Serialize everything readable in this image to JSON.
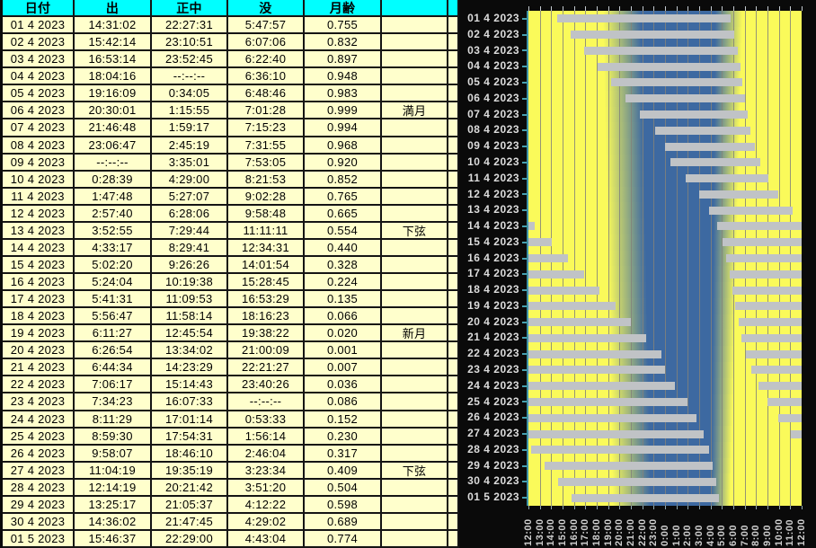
{
  "table": {
    "headers": [
      "日付",
      "出",
      "正中",
      "没",
      "月齢",
      ""
    ],
    "rows": [
      {
        "date": "01 4 2023",
        "rise": "14:31:02",
        "transit": "22:27:31",
        "set": "5:47:57",
        "age": "0.755",
        "phase": ""
      },
      {
        "date": "02 4 2023",
        "rise": "15:42:14",
        "transit": "23:10:51",
        "set": "6:07:06",
        "age": "0.832",
        "phase": ""
      },
      {
        "date": "03 4 2023",
        "rise": "16:53:14",
        "transit": "23:52:45",
        "set": "6:22:40",
        "age": "0.897",
        "phase": ""
      },
      {
        "date": "04 4 2023",
        "rise": "18:04:16",
        "transit": "--:--:--",
        "set": "6:36:10",
        "age": "0.948",
        "phase": ""
      },
      {
        "date": "05 4 2023",
        "rise": "19:16:09",
        "transit": "0:34:05",
        "set": "6:48:46",
        "age": "0.983",
        "phase": ""
      },
      {
        "date": "06 4 2023",
        "rise": "20:30:01",
        "transit": "1:15:55",
        "set": "7:01:28",
        "age": "0.999",
        "phase": "満月"
      },
      {
        "date": "07 4 2023",
        "rise": "21:46:48",
        "transit": "1:59:17",
        "set": "7:15:23",
        "age": "0.994",
        "phase": ""
      },
      {
        "date": "08 4 2023",
        "rise": "23:06:47",
        "transit": "2:45:19",
        "set": "7:31:55",
        "age": "0.968",
        "phase": ""
      },
      {
        "date": "09 4 2023",
        "rise": "--:--:--",
        "transit": "3:35:01",
        "set": "7:53:05",
        "age": "0.920",
        "phase": ""
      },
      {
        "date": "10 4 2023",
        "rise": "0:28:39",
        "transit": "4:29:00",
        "set": "8:21:53",
        "age": "0.852",
        "phase": ""
      },
      {
        "date": "11 4 2023",
        "rise": "1:47:48",
        "transit": "5:27:07",
        "set": "9:02:28",
        "age": "0.765",
        "phase": ""
      },
      {
        "date": "12 4 2023",
        "rise": "2:57:40",
        "transit": "6:28:06",
        "set": "9:58:48",
        "age": "0.665",
        "phase": ""
      },
      {
        "date": "13 4 2023",
        "rise": "3:52:55",
        "transit": "7:29:44",
        "set": "11:11:11",
        "age": "0.554",
        "phase": "下弦"
      },
      {
        "date": "14 4 2023",
        "rise": "4:33:17",
        "transit": "8:29:41",
        "set": "12:34:31",
        "age": "0.440",
        "phase": ""
      },
      {
        "date": "15 4 2023",
        "rise": "5:02:20",
        "transit": "9:26:26",
        "set": "14:01:54",
        "age": "0.328",
        "phase": ""
      },
      {
        "date": "16 4 2023",
        "rise": "5:24:04",
        "transit": "10:19:38",
        "set": "15:28:45",
        "age": "0.224",
        "phase": ""
      },
      {
        "date": "17 4 2023",
        "rise": "5:41:31",
        "transit": "11:09:53",
        "set": "16:53:29",
        "age": "0.135",
        "phase": ""
      },
      {
        "date": "18 4 2023",
        "rise": "5:56:47",
        "transit": "11:58:14",
        "set": "18:16:23",
        "age": "0.066",
        "phase": ""
      },
      {
        "date": "19 4 2023",
        "rise": "6:11:27",
        "transit": "12:45:54",
        "set": "19:38:22",
        "age": "0.020",
        "phase": "新月"
      },
      {
        "date": "20 4 2023",
        "rise": "6:26:54",
        "transit": "13:34:02",
        "set": "21:00:09",
        "age": "0.001",
        "phase": ""
      },
      {
        "date": "21 4 2023",
        "rise": "6:44:34",
        "transit": "14:23:29",
        "set": "22:21:27",
        "age": "0.007",
        "phase": ""
      },
      {
        "date": "22 4 2023",
        "rise": "7:06:17",
        "transit": "15:14:43",
        "set": "23:40:26",
        "age": "0.036",
        "phase": ""
      },
      {
        "date": "23 4 2023",
        "rise": "7:34:23",
        "transit": "16:07:33",
        "set": "--:--:--",
        "age": "0.086",
        "phase": ""
      },
      {
        "date": "24 4 2023",
        "rise": "8:11:29",
        "transit": "17:01:14",
        "set": "0:53:33",
        "age": "0.152",
        "phase": ""
      },
      {
        "date": "25 4 2023",
        "rise": "8:59:30",
        "transit": "17:54:31",
        "set": "1:56:14",
        "age": "0.230",
        "phase": ""
      },
      {
        "date": "26 4 2023",
        "rise": "9:58:07",
        "transit": "18:46:10",
        "set": "2:46:04",
        "age": "0.317",
        "phase": ""
      },
      {
        "date": "27 4 2023",
        "rise": "11:04:19",
        "transit": "19:35:19",
        "set": "3:23:34",
        "age": "0.409",
        "phase": "下弦"
      },
      {
        "date": "28 4 2023",
        "rise": "12:14:19",
        "transit": "20:21:42",
        "set": "3:51:20",
        "age": "0.504",
        "phase": ""
      },
      {
        "date": "29 4 2023",
        "rise": "13:25:17",
        "transit": "21:05:37",
        "set": "4:12:22",
        "age": "0.598",
        "phase": ""
      },
      {
        "date": "30 4 2023",
        "rise": "14:36:02",
        "transit": "21:47:45",
        "set": "4:29:02",
        "age": "0.689",
        "phase": ""
      },
      {
        "date": "01 5 2023",
        "rise": "15:46:37",
        "transit": "22:29:00",
        "set": "4:43:04",
        "age": "0.774",
        "phase": ""
      }
    ]
  },
  "chart_data": {
    "type": "bar",
    "subtype": "time-interval-gantt",
    "title": "",
    "x_axis": {
      "start": "12:00",
      "end": "12:00 (next day)",
      "tick_interval_hours": 1,
      "labels": [
        "12:00",
        "13:00",
        "14:00",
        "15:00",
        "16:00",
        "17:00",
        "18:00",
        "19:00",
        "20:00",
        "21:00",
        "22:00",
        "23:00",
        "0:00",
        "1:00",
        "2:00",
        "3:00",
        "4:00",
        "5:00",
        "6:00",
        "7:00",
        "8:00",
        "9:00",
        "10:00",
        "11:00",
        "12:00"
      ]
    },
    "y_axis": {
      "labels": [
        "01 4 2023",
        "02 4 2023",
        "03 4 2023",
        "04 4 2023",
        "05 4 2023",
        "06 4 2023",
        "07 4 2023",
        "08 4 2023",
        "09 4 2023",
        "10 4 2023",
        "11 4 2023",
        "12 4 2023",
        "13 4 2023",
        "14 4 2023",
        "15 4 2023",
        "16 4 2023",
        "17 4 2023",
        "18 4 2023",
        "19 4 2023",
        "20 4 2023",
        "21 4 2023",
        "22 4 2023",
        "23 4 2023",
        "24 4 2023",
        "25 4 2023",
        "26 4 2023",
        "27 4 2023",
        "28 4 2023",
        "29 4 2023",
        "30 4 2023",
        "01 5 2023"
      ]
    },
    "bars": [
      [
        "14:31:02",
        "5:47:57"
      ],
      [
        "15:42:14",
        "6:07:06"
      ],
      [
        "16:53:14",
        "6:22:40"
      ],
      [
        "18:04:16",
        "6:36:10"
      ],
      [
        "19:16:09",
        "6:48:46"
      ],
      [
        "20:30:01",
        "7:01:28"
      ],
      [
        "21:46:48",
        "7:15:23"
      ],
      [
        "23:06:47",
        "7:31:55"
      ],
      [
        null,
        "7:53:05"
      ],
      [
        "0:28:39",
        "8:21:53"
      ],
      [
        "1:47:48",
        "9:02:28"
      ],
      [
        "2:57:40",
        "9:58:48"
      ],
      [
        "3:52:55",
        "11:11:11"
      ],
      [
        "4:33:17",
        "12:34:31"
      ],
      [
        "5:02:20",
        "14:01:54"
      ],
      [
        "5:24:04",
        "15:28:45"
      ],
      [
        "5:41:31",
        "16:53:29"
      ],
      [
        "5:56:47",
        "18:16:23"
      ],
      [
        "6:11:27",
        "19:38:22"
      ],
      [
        "6:26:54",
        "21:00:09"
      ],
      [
        "6:44:34",
        "22:21:27"
      ],
      [
        "7:06:17",
        "23:40:26"
      ],
      [
        "7:34:23",
        null
      ],
      [
        "8:11:29",
        "0:53:33"
      ],
      [
        "8:59:30",
        "1:56:14"
      ],
      [
        "9:58:07",
        "2:46:04"
      ],
      [
        "11:04:19",
        "3:23:34"
      ],
      [
        "12:14:19",
        "3:51:20"
      ],
      [
        "13:25:17",
        "4:12:22"
      ],
      [
        "14:36:02",
        "4:29:02"
      ],
      [
        "15:46:37",
        "4:43:04"
      ]
    ],
    "night_band": {
      "description": "blue night region on yellow day background, hours after noon [yellow_until, full_blue_from, full_blue_until, yellow_from]",
      "first_row": [
        6.55,
        9.9,
        16.4,
        18.8
      ],
      "last_row": [
        7.4,
        10.75,
        16.05,
        17.75
      ]
    },
    "legend": "none",
    "grid": true
  },
  "colors": {
    "header_bg": "#00FFFF",
    "cell_bg": "#FFFFCC",
    "day_yellow": "#FAFA5A",
    "night_blue": "#3D69A1",
    "bar_gray": "#C0C3C6",
    "gridline": "#82827A",
    "axis_cyan": "#3E93A5",
    "label_gray": "#DCDCDC",
    "background": "#000000"
  }
}
